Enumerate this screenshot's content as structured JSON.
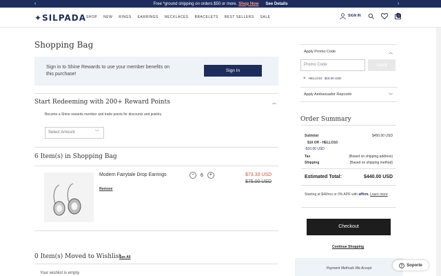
{
  "promo_bar": {
    "text": "Free *ground shipping on orders $50 or more.",
    "link": "Shop Now",
    "details": "See Details"
  },
  "header": {
    "logo": "SILPADA",
    "nav": [
      "SHOP",
      "NEW",
      "RINGS",
      "EARRINGS",
      "NECKLACES",
      "BRACELETS",
      "BEST SELLERS",
      "SALE"
    ],
    "signin": "SIGN IN",
    "cart_count": "0"
  },
  "page": {
    "title": "Shopping Bag",
    "signin_text": "Sign in to Shine Rewards to use your member benefits on this purchase!",
    "signin_button": "Sign In",
    "rewards_heading": "Start Redeeming with 200+ Reward Points",
    "rewards_desc": "Become a Shine rewards member and trade points for discounts and jewelry.",
    "select_placeholder": "Select Amount",
    "items_heading": "6 Item(s) in Shopping Bag",
    "wishlist_heading": "0 Item(s) Moved to Wishlist",
    "see_all": "See All",
    "wishlist_empty": "Your wishlist is empty"
  },
  "item": {
    "name": "Modern Fairytale Drop Earrings",
    "remove": "Remove",
    "qty": "6",
    "sale_price": "$73.33 USD",
    "original_price": "$75.00 USD"
  },
  "sidebar": {
    "promo_label": "Apply Promo Code",
    "promo_placeholder": "Promo Code",
    "apply": "Apply",
    "applied_code": "HELLO10",
    "applied_amount": "$10.00 USD",
    "ambassador_label": "Apply Ambassador Repcode",
    "summary_title": "Order Summary",
    "subtotal_label": "Subtotal",
    "subtotal_value": "$450.00 USD",
    "discount_label": "$10 Off - HELLO10",
    "discount_value": "-$10.00 USD",
    "tax_label": "Tax",
    "tax_value": "(Based on shipping address)",
    "shipping_label": "Shipping",
    "shipping_value": "(Based on shipping method)",
    "estimated_label": "Estimated Total:",
    "estimated_value": "$440.00 USD",
    "affirm_text": "Starting at $40/mo or 0% APR with",
    "affirm_brand": "affirm.",
    "affirm_link": "Learn more",
    "checkout": "Checkout",
    "continue": "Continue Shopping",
    "payment_methods": "Payment Methods We Accept"
  },
  "support": "Soporte"
}
